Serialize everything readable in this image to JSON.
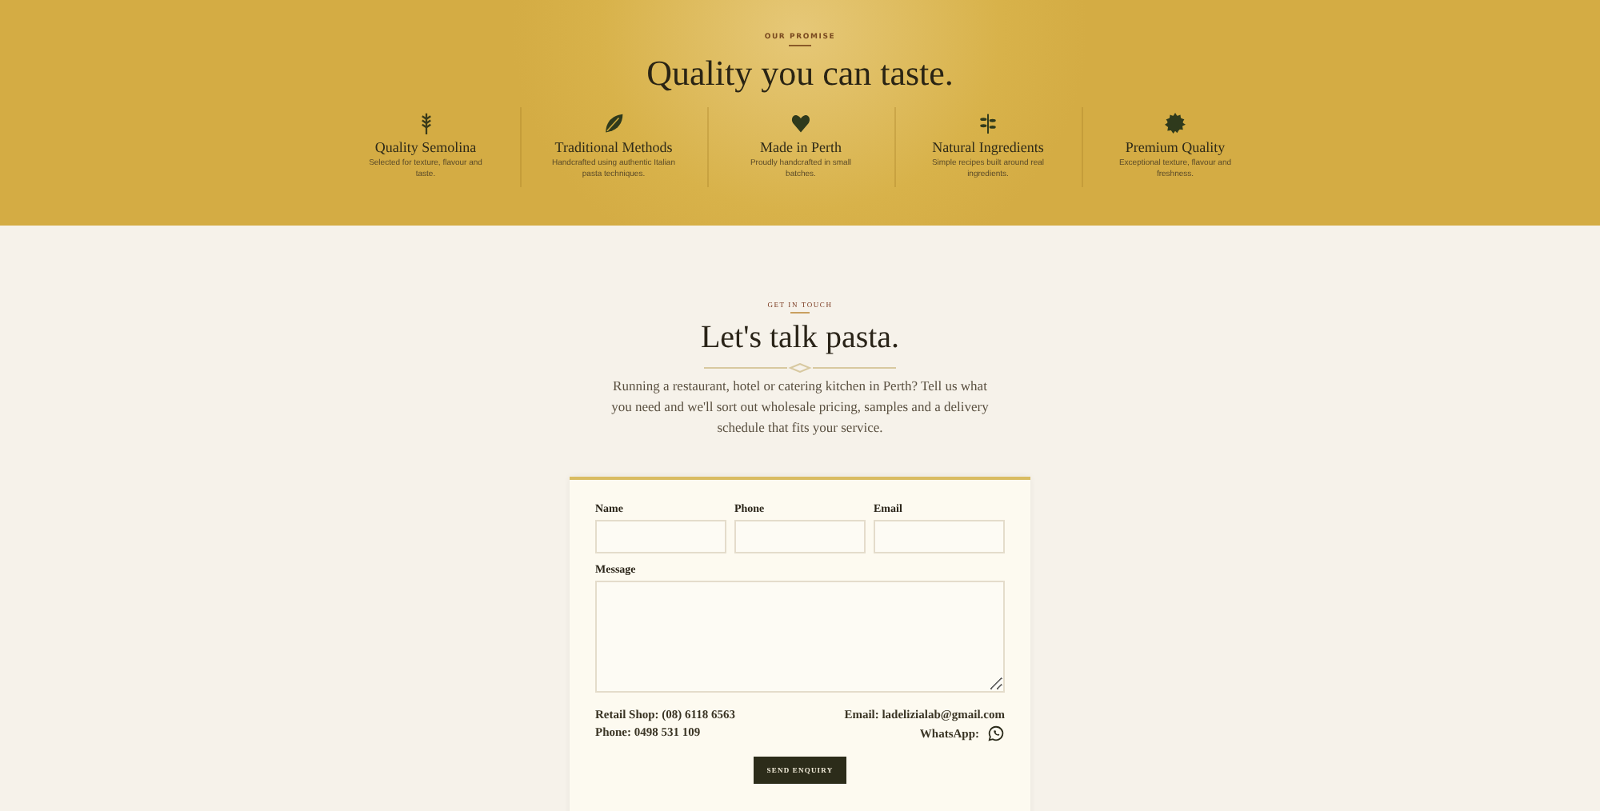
{
  "promise": {
    "overline": "OUR PROMISE",
    "title": "Quality you can taste.",
    "features": [
      {
        "title": "Quality Semolina",
        "text": "Selected for texture, flavour and taste."
      },
      {
        "title": "Traditional Methods",
        "text": "Handcrafted using authentic Italian pasta techniques."
      },
      {
        "title": "Made in Perth",
        "text": "Proudly handcrafted in small batches."
      },
      {
        "title": "Natural Ingredients",
        "text": "Simple recipes built around real ingredients."
      },
      {
        "title": "Premium Quality",
        "text": "Exceptional texture, flavour and freshness."
      }
    ]
  },
  "contact": {
    "overline": "GET IN TOUCH",
    "title": "Let's talk pasta.",
    "intro": "Running a restaurant, hotel or catering kitchen in Perth? Tell us what you need and we'll sort out wholesale pricing, samples and a delivery schedule that fits your service.",
    "form": {
      "fields": [
        {
          "label": "Name"
        },
        {
          "label": "Phone"
        },
        {
          "label": "Email"
        }
      ],
      "message_label": "Message",
      "retail": "Retail Shop: (08) 6118 6563",
      "phone": "Phone: 0498 531 109",
      "email": "Email: ladelizialab@gmail.com",
      "whatsapp": "WhatsApp:",
      "button": "SEND ENQUIRY"
    }
  }
}
